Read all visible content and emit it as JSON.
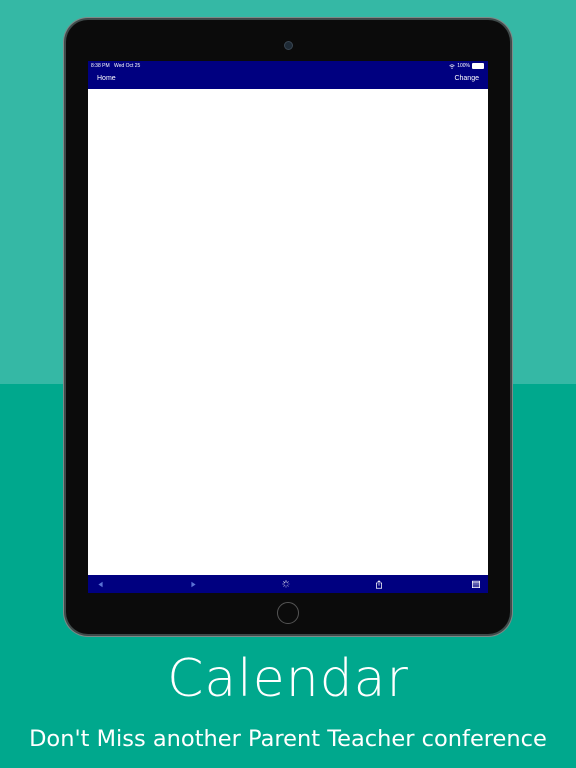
{
  "status_bar": {
    "time": "8:38 PM",
    "date": "Wed Oct 25",
    "battery": "100%"
  },
  "nav_bar": {
    "left_label": "Home",
    "right_label": "Change"
  },
  "toolbar": {
    "icons": [
      "back-arrow-icon",
      "forward-arrow-icon",
      "loading-spinner-icon",
      "share-icon",
      "calendar-icon"
    ]
  },
  "caption": {
    "title": "Calendar",
    "subtitle": "Don't Miss another Parent Teacher conference"
  },
  "colors": {
    "background_top": "#35b8a5",
    "background_bottom": "#00a88d",
    "bar": "#000080",
    "screen": "#ffffff",
    "device": "#0b0b0b"
  }
}
